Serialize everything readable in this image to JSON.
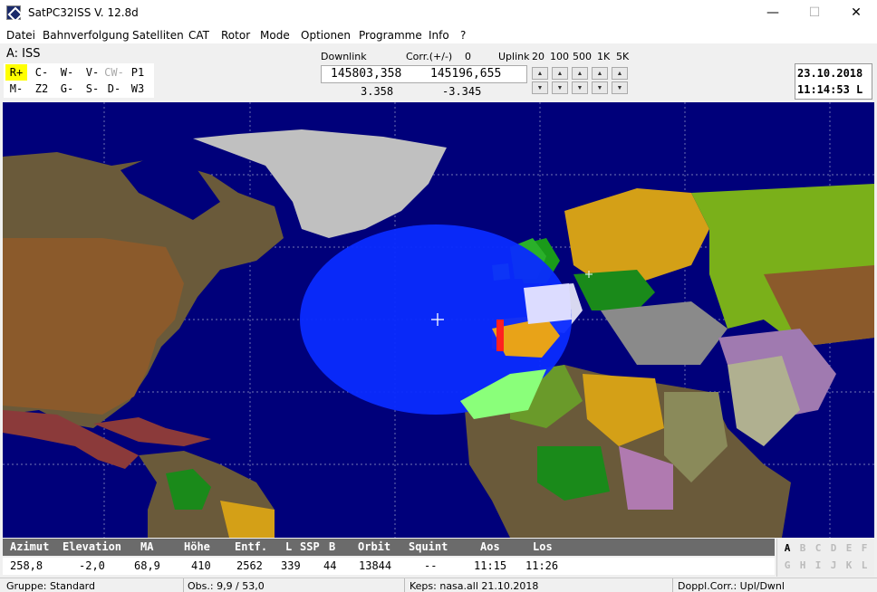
{
  "window": {
    "title": "SatPC32ISS V. 12.8d",
    "minimize": "—",
    "maximize": "☐",
    "close": "✕"
  },
  "menu": [
    "Datei",
    "Bahnverfolgung",
    "Satelliten",
    "CAT",
    "Rotor",
    "Mode",
    "Optionen",
    "Programme",
    "Info",
    "?"
  ],
  "satellite": {
    "label": "A: ISS"
  },
  "modes": [
    [
      "R+",
      "C-",
      "W-",
      "V-",
      "CW-",
      "P1"
    ],
    [
      "M-",
      "Z2",
      "G-",
      "S-",
      "D-",
      "W3"
    ]
  ],
  "frequency": {
    "downlink_label": "Downlink",
    "corr_label": "Corr.(+/-)",
    "corr_value": "0",
    "uplink_label": "Uplink",
    "steps": [
      "20",
      "100",
      "500",
      "1K",
      "5K"
    ],
    "downlink": "145803,358",
    "uplink": "145196,655",
    "doppler_down": "3.358",
    "doppler_up": "-3.345"
  },
  "clock": {
    "date": "23.10.2018",
    "time": "11:14:53 L"
  },
  "telemetry": {
    "headers": [
      "Azimut",
      "Elevation",
      "MA",
      "Höhe",
      "Entf.",
      "L",
      "SSP",
      "B",
      "Orbit",
      "Squint",
      "Aos",
      "Los"
    ],
    "values": [
      "258,8",
      "-2,0",
      "68,9",
      "410",
      "2562",
      "339",
      "44",
      "13844",
      "--",
      "11:15",
      "11:26"
    ]
  },
  "slots": [
    [
      "A",
      "B",
      "C",
      "D",
      "E",
      "F"
    ],
    [
      "G",
      "H",
      "I",
      "J",
      "K",
      "L"
    ]
  ],
  "active_slot": "A",
  "status": {
    "group": "Gruppe: Standard",
    "obs": "Obs.: 9,9 / 53,0",
    "keps": "Keps: nasa.all 21.10.2018",
    "doppler": "Doppl.Corr.: Upl/Dwnl"
  },
  "colors": {
    "ocean": "#00007a",
    "footprint": "#0a2bff",
    "mode_active": "#ffff00"
  }
}
